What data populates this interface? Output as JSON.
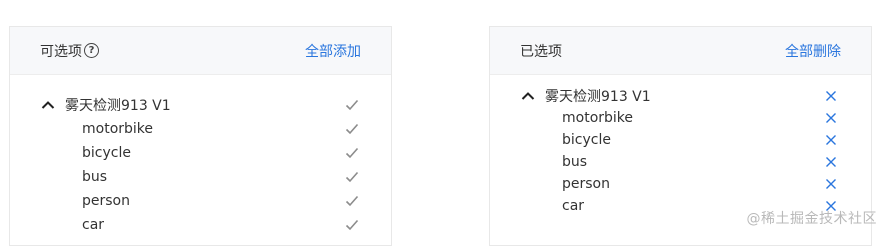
{
  "available": {
    "title": "可选项",
    "help_icon": "question-circle-icon",
    "action": "全部添加",
    "group": {
      "label": "雾天检测913 V1",
      "items": [
        "motorbike",
        "bicycle",
        "bus",
        "person",
        "car"
      ]
    }
  },
  "selected": {
    "title": "已选项",
    "action": "全部删除",
    "group": {
      "label": "雾天检测913 V1",
      "items": [
        "motorbike",
        "bicycle",
        "bus",
        "person",
        "car"
      ]
    }
  },
  "watermark": "@稀土掘金技术社区",
  "colors": {
    "accent": "#2a76de",
    "check": "#8c8c8c",
    "header_bg": "#f7f8fa"
  }
}
